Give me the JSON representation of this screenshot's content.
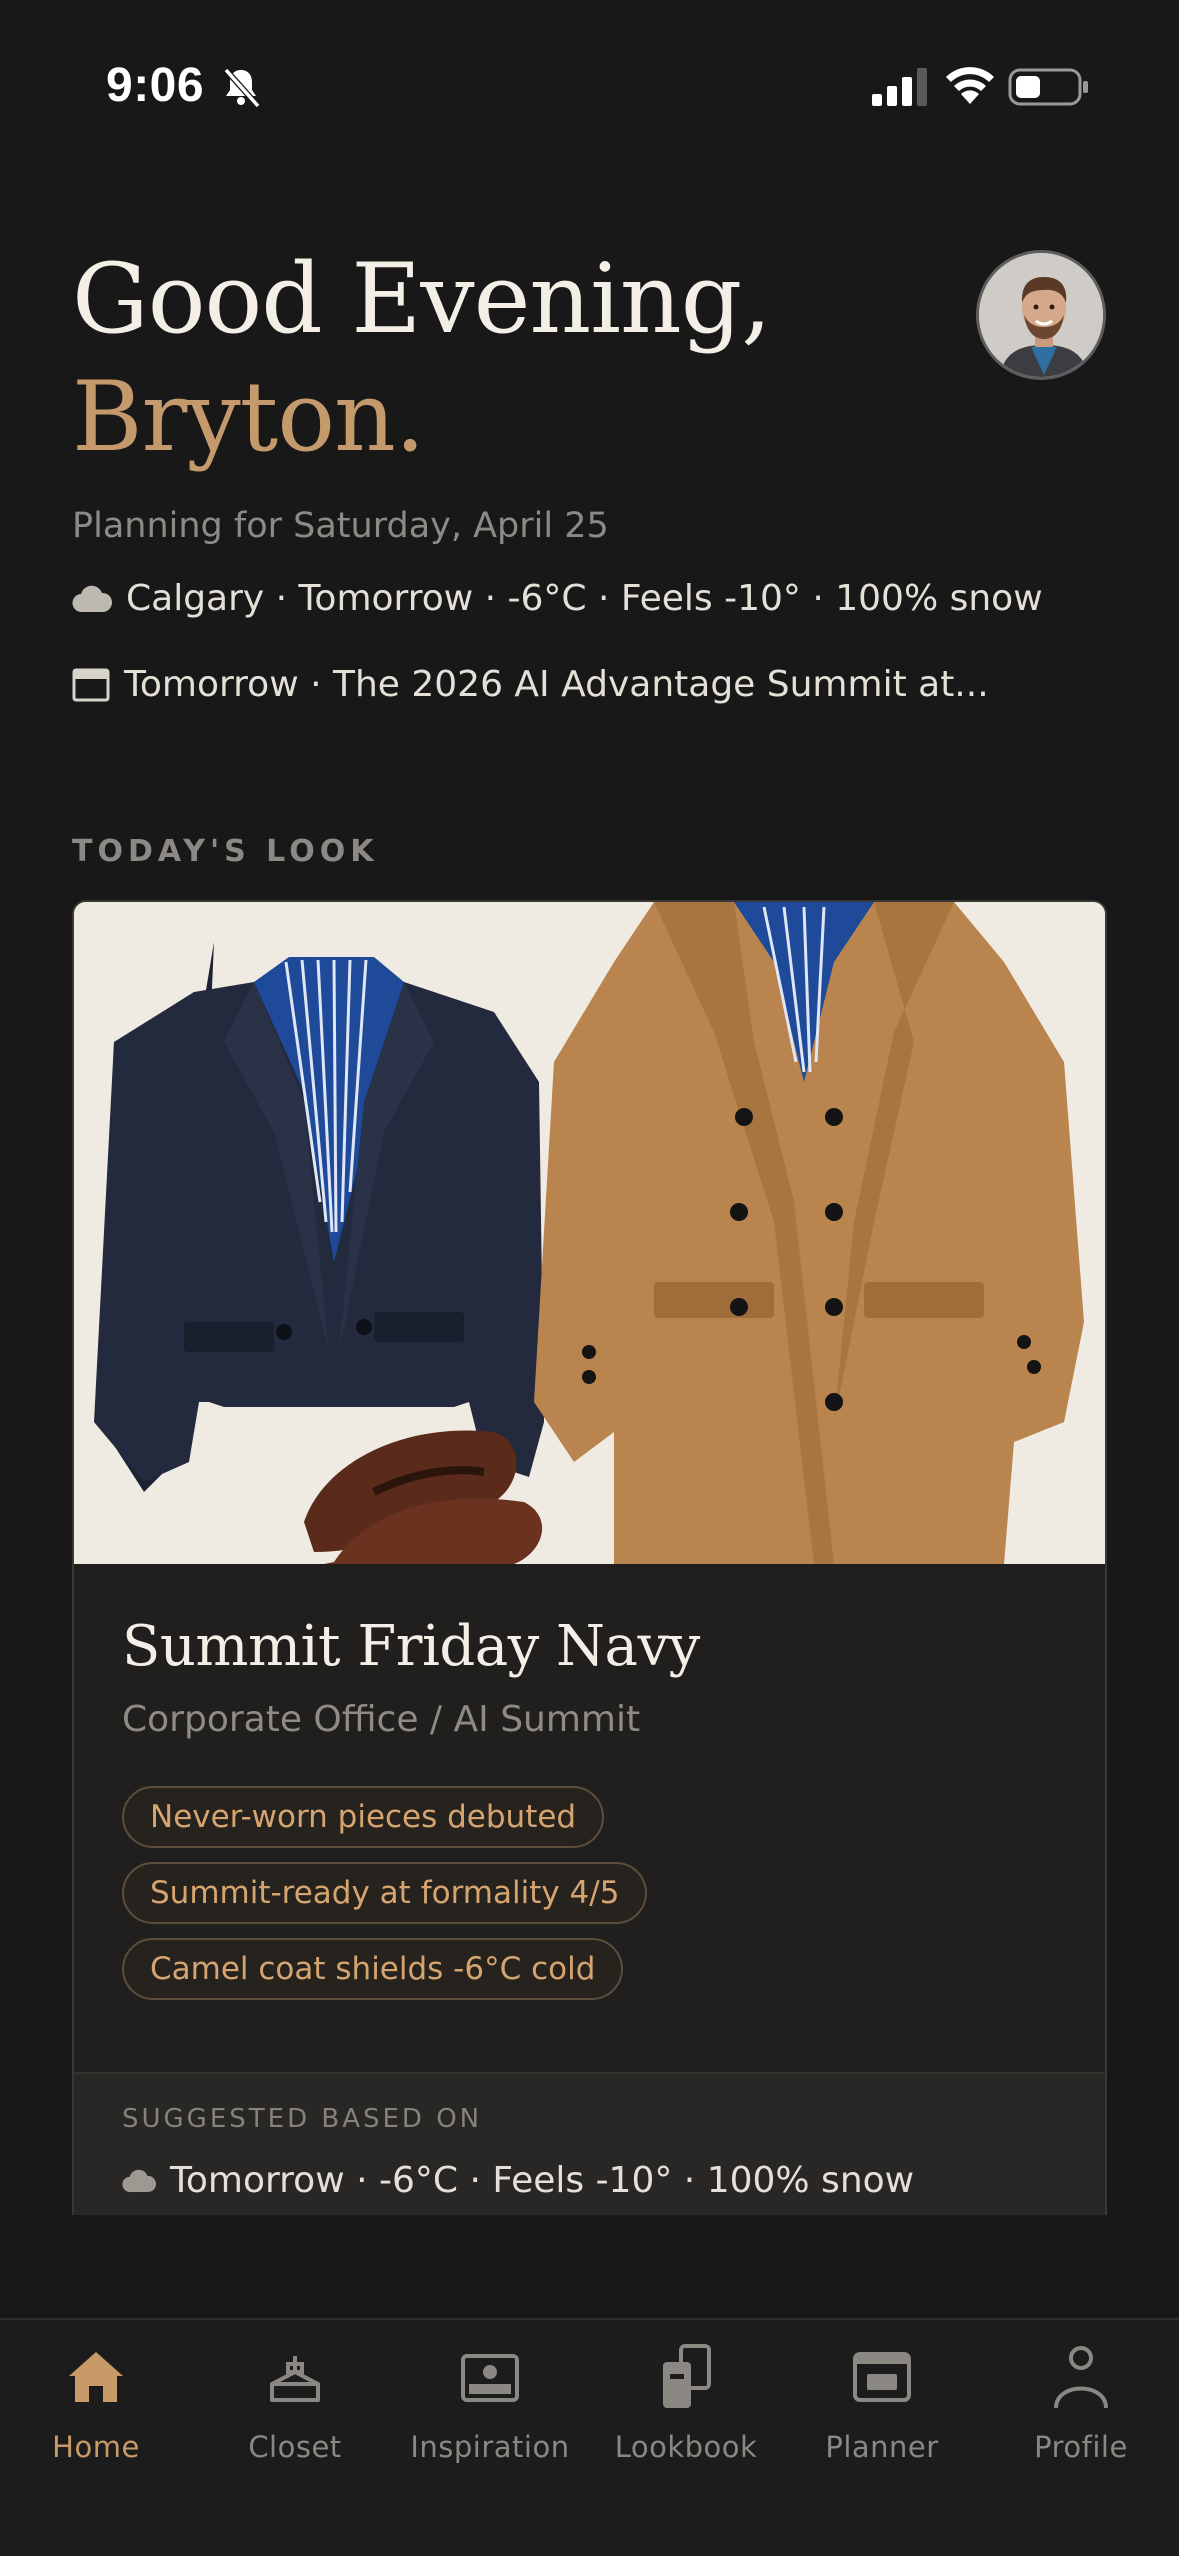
{
  "status_bar": {
    "time": "9:06",
    "icons": [
      "bell-slash-icon",
      "signal-icon",
      "wifi-icon",
      "battery-icon"
    ]
  },
  "header": {
    "greeting": "Good Evening,",
    "name": "Bryton.",
    "planning": "Planning for Saturday, April 25",
    "weather": "Calgary · Tomorrow · -6°C · Feels -10° · 100% snow",
    "event": "Tomorrow · The 2026 AI Advantage Summit at..."
  },
  "section": {
    "label": "TODAY'S LOOK"
  },
  "look": {
    "title": "Summit Friday Navy",
    "subtitle": "Corporate Office / AI Summit",
    "tags": [
      "Never-worn pieces debuted",
      "Summit-ready at formality 4/5",
      "Camel coat shields -6°C cold"
    ],
    "suggested_label": "SUGGESTED BASED ON",
    "suggested_text": "Tomorrow · -6°C · Feels -10° · 100% snow"
  },
  "tabs": [
    {
      "label": "Home",
      "icon": "home-icon",
      "active": true
    },
    {
      "label": "Closet",
      "icon": "hanger-icon",
      "active": false
    },
    {
      "label": "Inspiration",
      "icon": "image-icon",
      "active": false
    },
    {
      "label": "Lookbook",
      "icon": "lookbook-icon",
      "active": false
    },
    {
      "label": "Planner",
      "icon": "calendar-icon",
      "active": false
    },
    {
      "label": "Profile",
      "icon": "person-icon",
      "active": false
    }
  ],
  "colors": {
    "background": "#181818",
    "accent": "#c49a6c",
    "card": "#201f1e",
    "muted_text": "#8d8a85"
  }
}
